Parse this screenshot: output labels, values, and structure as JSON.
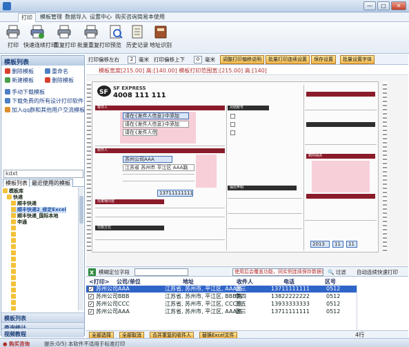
{
  "window": {
    "title": "",
    "controls": [
      "—",
      "□",
      "✕"
    ]
  },
  "menu": {
    "tabs": [
      "打印",
      "模板管理",
      "数据导入",
      "设置中心",
      "购买咨询简易本使用"
    ]
  },
  "ribbon": {
    "buttons": [
      {
        "label": "打印",
        "icon": "printer-icon"
      },
      {
        "label": "快速连续打印",
        "icon": "print-queue-icon"
      },
      {
        "label": "重复打印",
        "icon": "reprint-icon"
      },
      {
        "label": "批量重复打印",
        "icon": "batch-print-icon"
      },
      {
        "label": "预览",
        "icon": "preview-icon"
      },
      {
        "label": "历史记录",
        "icon": "history-icon"
      },
      {
        "label": "地址识别",
        "icon": "address-book-icon"
      }
    ]
  },
  "left_panel": {
    "title": "模板列表",
    "actions": [
      {
        "label": "删除模板",
        "color": "#d8402f"
      },
      {
        "label": "重命名",
        "color": "#4f7fc4"
      },
      {
        "label": "新建模板",
        "color": "#4aa04a"
      },
      {
        "label": "删除模板",
        "color": "#d8402f"
      },
      {
        "label": "手动下载模板",
        "color": "#4f7fc4"
      },
      {
        "label": "下载免费的所有设计打印软件",
        "color": "#4f7fc4"
      },
      {
        "label": "加入qq群和其他用户交流模板",
        "color": "#e0902a"
      }
    ],
    "search_value": "kdxt",
    "tabs": [
      "模板列表",
      "最近使用的模板"
    ],
    "tree": [
      {
        "label": "模板库",
        "color": "#f2c23a",
        "indent": 0
      },
      {
        "label": "快递",
        "color": "#f2c23a",
        "indent": 1
      },
      {
        "label": "顺丰快递",
        "color": "#f2c23a",
        "indent": 2
      },
      {
        "label": "顺丰快递2_修定Excel",
        "color": "#f2c23a",
        "indent": 2,
        "selected": true
      },
      {
        "label": "顺丰快递_国际本地",
        "color": "#f2c23a",
        "indent": 2
      },
      {
        "label": "申通",
        "color": "#f2c23a",
        "indent": 2
      },
      {
        "label": "",
        "color": "#f2c23a",
        "indent": 2
      },
      {
        "label": "",
        "color": "#f2c23a",
        "indent": 2
      },
      {
        "label": "",
        "color": "#f2c23a",
        "indent": 2
      },
      {
        "label": "",
        "color": "#f2c23a",
        "indent": 2
      },
      {
        "label": "",
        "color": "#f2c23a",
        "indent": 2
      },
      {
        "label": "",
        "color": "#f2c23a",
        "indent": 2
      },
      {
        "label": "",
        "color": "#f2c23a",
        "indent": 2
      },
      {
        "label": "",
        "color": "#f2c23a",
        "indent": 2
      },
      {
        "label": "",
        "color": "#f2c23a",
        "indent": 2
      },
      {
        "label": "",
        "color": "#f2c23a",
        "indent": 2
      },
      {
        "label": "",
        "color": "#f2c23a",
        "indent": 2
      },
      {
        "label": "",
        "color": "#f2c23a",
        "indent": 2
      },
      {
        "label": "",
        "color": "#f2c23a",
        "indent": 2
      },
      {
        "label": "",
        "color": "#f2c23a",
        "indent": 2
      }
    ],
    "bottom_tabs": [
      "模板列表",
      "查询统计",
      "视频教程"
    ]
  },
  "main_toolbar": {
    "offset_x_label": "打印偏移左右",
    "offset_x_value": "2",
    "offset_unit": "毫米",
    "offset_y_label": "打印偏移上下",
    "offset_y_value": "0",
    "offset_y_unit": "毫米",
    "buttons": [
      "调整打印偏移说明",
      "批量打印连续设置",
      "保存设置",
      "批量设置字体"
    ]
  },
  "ruler": {
    "text": "模板宽度[215.00] 高:[140.00]  模板打印范围宽:[215.00] 高:[140]"
  },
  "form": {
    "brand": "SF EXPRESS",
    "hotline": "4008 111 111",
    "fields": [
      "请在{发件人信息}中添加",
      "请在{发件人信息}中添加",
      "请在{发件人信息}中添加",
      "苏州公司AAA",
      "江苏省 苏州市 平江区 AAA路",
      "13711111111",
      "2013",
      "11",
      "11"
    ],
    "labels": [
      "寄件人",
      "收件人",
      "托寄物内容",
      "月结账号",
      "付款方式",
      "保价声明",
      "到件网点"
    ]
  },
  "bottom_bar": {
    "filter_label": "模糊定位字段",
    "input_value": "使用后会覆盖功能，同实例连续保存数据(公司)",
    "filter_button": "过滤",
    "auto_label": "自动连续快速打印"
  },
  "table": {
    "headers": [
      "打印",
      "公司/单位",
      "地址",
      "收件人",
      "电话",
      "区号"
    ],
    "rows": [
      {
        "company": "苏州公司AAA",
        "address": "江苏省, 苏州市, 平江区, AAA路",
        "name": "张三",
        "phone": "13711111111",
        "zip": "0512",
        "selected": true
      },
      {
        "company": "苏州公司BBB",
        "address": "江苏省, 苏州市, 平江区, BBB路",
        "name": "李四",
        "phone": "13822222222",
        "zip": "0512"
      },
      {
        "company": "苏州公司CCC",
        "address": "江苏省, 苏州市, 平江区, CCC路",
        "name": "王五",
        "phone": "13933333333",
        "zip": "0512"
      },
      {
        "company": "苏州公司AAA",
        "address": "江苏省, 苏州市, 平江区, AAA路",
        "name": "张三",
        "phone": "13711111111",
        "zip": "0512"
      }
    ]
  },
  "status_buttons": [
    "全部选择",
    "全部取消",
    "合并重复的收件人",
    "替换Excel文件"
  ],
  "row_count": "4行",
  "statusbar": {
    "left": "购买咨询",
    "right": "提示:0/5)   本软件不适用于标准打印"
  },
  "colors": {
    "accent": "#2f64c9",
    "form_red": "#8a1b2a",
    "pink_field": "#f6cfd9"
  }
}
